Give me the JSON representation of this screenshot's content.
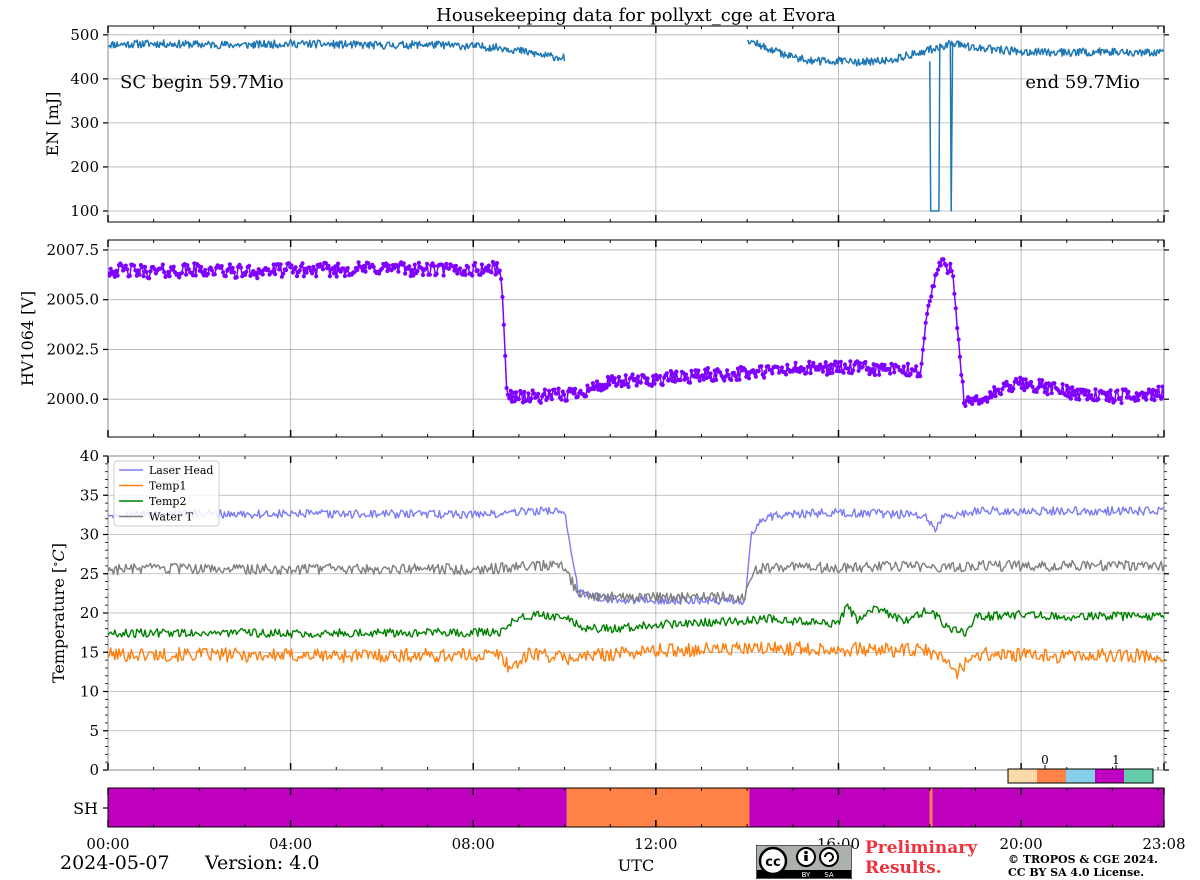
{
  "chart_data": [
    {
      "type": "line",
      "title": "Housekeeping data for pollyxt_cge at Evora",
      "ylabel": "EN [mJ]",
      "ylim": [
        75,
        520
      ],
      "yticks": [
        100,
        200,
        300,
        400,
        500
      ],
      "annotations": [
        "SC begin 59.7Mio",
        "end 59.7Mio"
      ],
      "color": "#1f77b4",
      "series": [
        {
          "segments": [
            {
              "x": [
                0,
                1,
                2,
                3,
                4,
                5,
                6,
                7,
                8,
                8.7,
                9.2,
                9.6,
                10.0
              ],
              "y": [
                478,
                480,
                478,
                477,
                480,
                478,
                476,
                478,
                474,
                470,
                460,
                452,
                448
              ]
            },
            {
              "x": [
                14.0,
                14.4,
                15.0,
                15.5,
                16.0,
                16.5,
                17.0,
                17.4,
                17.8,
                18.2,
                18.5,
                19.0,
                20.0,
                21.0,
                22.0,
                23.13
              ],
              "y": [
                490,
                470,
                450,
                440,
                440,
                438,
                440,
                450,
                460,
                472,
                480,
                470,
                462,
                460,
                462,
                458
              ]
            },
            {
              "x": [
                18.0,
                18.02,
                18.2,
                18.22
              ],
              "y": [
                440,
                100,
                100,
                480
              ]
            },
            {
              "x": [
                18.45,
                18.47,
                18.5
              ],
              "y": [
                480,
                100,
                480
              ]
            }
          ]
        }
      ]
    },
    {
      "type": "line",
      "ylabel": "HV1064 [V]",
      "ylim": [
        1998.1,
        2008.0
      ],
      "yticks": [
        "2000.0",
        "2002.5",
        "2005.0",
        "2007.5"
      ],
      "color": "#7f00ff",
      "markers": true,
      "series": [
        {
          "x": [
            0,
            1,
            2,
            3,
            4,
            5,
            6,
            7,
            8,
            8.6,
            8.75,
            8.85,
            9.3,
            10.0,
            11.0,
            12.0,
            13.0,
            14.0,
            15.0,
            16.0,
            17.0,
            17.8,
            17.95,
            18.2,
            18.5,
            18.75,
            19.0,
            19.5,
            20.0,
            20.5,
            21.0,
            22.0,
            23.13
          ],
          "y": [
            2006.5,
            2006.4,
            2006.5,
            2006.4,
            2006.5,
            2006.5,
            2006.6,
            2006.5,
            2006.5,
            2006.6,
            2000.0,
            2000.2,
            2000.1,
            2000.2,
            2000.8,
            2001.0,
            2001.2,
            2001.3,
            2001.5,
            2001.6,
            2001.5,
            2001.4,
            2004.5,
            2006.8,
            2006.6,
            1999.8,
            1999.8,
            2000.4,
            2000.8,
            2000.6,
            2000.4,
            2000.1,
            2000.3
          ]
        }
      ]
    },
    {
      "type": "line",
      "ylabel": "Temperature [$^\\circ C$]",
      "ylim": [
        0,
        40
      ],
      "yticks": [
        0,
        5,
        10,
        15,
        20,
        25,
        30,
        35,
        40
      ],
      "legend_position": "top-left",
      "series": [
        {
          "name": "Laser Head",
          "color": "#7b7bf5",
          "x": [
            0,
            8.0,
            8.6,
            9.1,
            10.0,
            10.15,
            10.3,
            11.0,
            12.0,
            13.0,
            13.95,
            14.1,
            14.3,
            14.6,
            16.0,
            17.9,
            18.1,
            18.3,
            19.0,
            20.0,
            23.13
          ],
          "y": [
            32.6,
            32.6,
            32.6,
            33.0,
            33.0,
            28.0,
            22.5,
            21.8,
            21.6,
            21.6,
            21.6,
            30.5,
            31.6,
            32.5,
            32.8,
            32.5,
            30.5,
            32.2,
            33.0,
            33.0,
            33.0
          ]
        },
        {
          "name": "Temp1",
          "color": "#ff7f0e",
          "x": [
            0,
            2,
            4,
            6,
            8,
            8.6,
            8.8,
            9.3,
            10.0,
            11.0,
            12.0,
            13.0,
            14.0,
            15.0,
            16.0,
            17.0,
            17.9,
            18.3,
            18.6,
            19.0,
            20.0,
            21.0,
            22.0,
            23.13
          ],
          "y": [
            14.7,
            14.7,
            14.6,
            14.6,
            14.6,
            14.7,
            13.0,
            15.0,
            14.2,
            14.8,
            15.2,
            15.4,
            15.4,
            15.5,
            15.4,
            15.3,
            15.2,
            14.2,
            12.5,
            14.8,
            14.6,
            14.5,
            14.6,
            14.5
          ]
        },
        {
          "name": "Temp2",
          "color": "#008000",
          "x": [
            0,
            2,
            4,
            6,
            8,
            8.6,
            9.0,
            9.5,
            10.0,
            10.5,
            11.0,
            12.0,
            13.0,
            14.0,
            14.5,
            15.0,
            16.0,
            16.2,
            16.4,
            16.8,
            17.5,
            18.0,
            18.4,
            18.8,
            19.0,
            20.0,
            21.0,
            22.0,
            23.13
          ],
          "y": [
            17.4,
            17.5,
            17.4,
            17.5,
            17.5,
            17.6,
            19.5,
            19.8,
            19.5,
            18.0,
            18.0,
            18.5,
            18.8,
            19.0,
            19.3,
            19.0,
            18.6,
            21.0,
            19.0,
            20.5,
            19.0,
            20.5,
            18.0,
            17.5,
            19.5,
            19.8,
            19.5,
            19.6,
            19.5
          ]
        },
        {
          "name": "Water T",
          "color": "#7f7f7f",
          "x": [
            0,
            2,
            4,
            6,
            8,
            8.6,
            9.0,
            9.6,
            10.0,
            10.2,
            10.4,
            11.0,
            12.0,
            13.0,
            13.95,
            14.1,
            14.3,
            15.0,
            16.0,
            17.0,
            18.0,
            18.3,
            19.0,
            20.0,
            21.0,
            22.0,
            23.13
          ],
          "y": [
            25.6,
            25.6,
            25.6,
            25.6,
            25.6,
            25.7,
            26.0,
            26.0,
            26.0,
            23.5,
            22.0,
            22.0,
            22.0,
            22.0,
            22.0,
            25.0,
            25.7,
            25.8,
            25.8,
            25.9,
            26.0,
            25.6,
            26.0,
            26.0,
            26.0,
            26.1,
            26.0
          ]
        }
      ]
    },
    {
      "type": "heatmap",
      "ylabel": "SH",
      "colorbar_ticks": [
        "0",
        "1"
      ],
      "colors": [
        "#fcd9a8",
        "#ff8247",
        "#87ceeb",
        "#bf00bf",
        "#66cdaa"
      ],
      "segments": [
        {
          "x0": 0,
          "x1": 10.05,
          "value": "purple"
        },
        {
          "x0": 10.05,
          "x1": 14.05,
          "value": "orange"
        },
        {
          "x0": 14.05,
          "x1": 18.0,
          "value": "purple"
        },
        {
          "x0": 18.0,
          "x1": 18.06,
          "value": "orange"
        },
        {
          "x0": 18.06,
          "x1": 23.13,
          "value": "purple"
        }
      ]
    }
  ],
  "x_axis": {
    "label": "UTC",
    "range": [
      0,
      23.13
    ],
    "ticks": [
      {
        "x": 0,
        "label": "00:00"
      },
      {
        "x": 4,
        "label": "04:00"
      },
      {
        "x": 8,
        "label": "08:00"
      },
      {
        "x": 12,
        "label": "12:00"
      },
      {
        "x": 16,
        "label": "16:00"
      },
      {
        "x": 20,
        "label": "20:00"
      },
      {
        "x": 23.13,
        "label": "23:08"
      }
    ]
  },
  "footer": {
    "date": "2024-05-07",
    "version": "Version: 4.0",
    "preliminary_line1": "Preliminary",
    "preliminary_line2": "Results.",
    "copyright_line1": "© TROPOS & CGE 2024.",
    "copyright_line2": "CC BY SA 4.0 License.",
    "license_badge_text": [
      "BY",
      "SA"
    ]
  }
}
